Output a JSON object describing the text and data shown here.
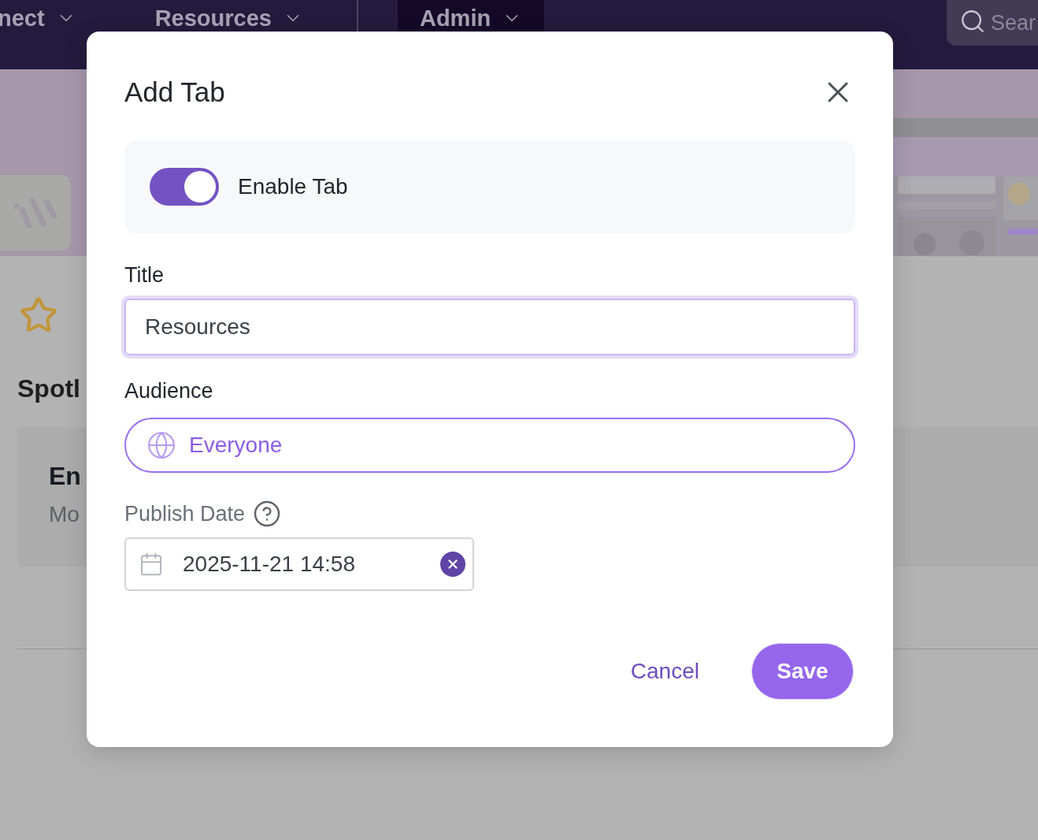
{
  "nav": {
    "items": [
      {
        "label": "nect",
        "selected": false
      },
      {
        "label": "Resources",
        "selected": false
      },
      {
        "label": "Admin",
        "selected": true
      }
    ],
    "search": {
      "placeholder": "Sear"
    }
  },
  "page": {
    "section_title": "Spotl",
    "card": {
      "title": "En",
      "subtitle": "Mo"
    }
  },
  "dialog": {
    "title": "Add Tab",
    "enable_tab": {
      "label": "Enable Tab",
      "on": true
    },
    "title_field": {
      "label": "Title",
      "value": "Resources"
    },
    "audience_field": {
      "label": "Audience",
      "value": "Everyone"
    },
    "publish_date_field": {
      "label": "Publish Date",
      "value": "2025-11-21 14:58"
    },
    "buttons": {
      "cancel": "Cancel",
      "save": "Save"
    }
  }
}
